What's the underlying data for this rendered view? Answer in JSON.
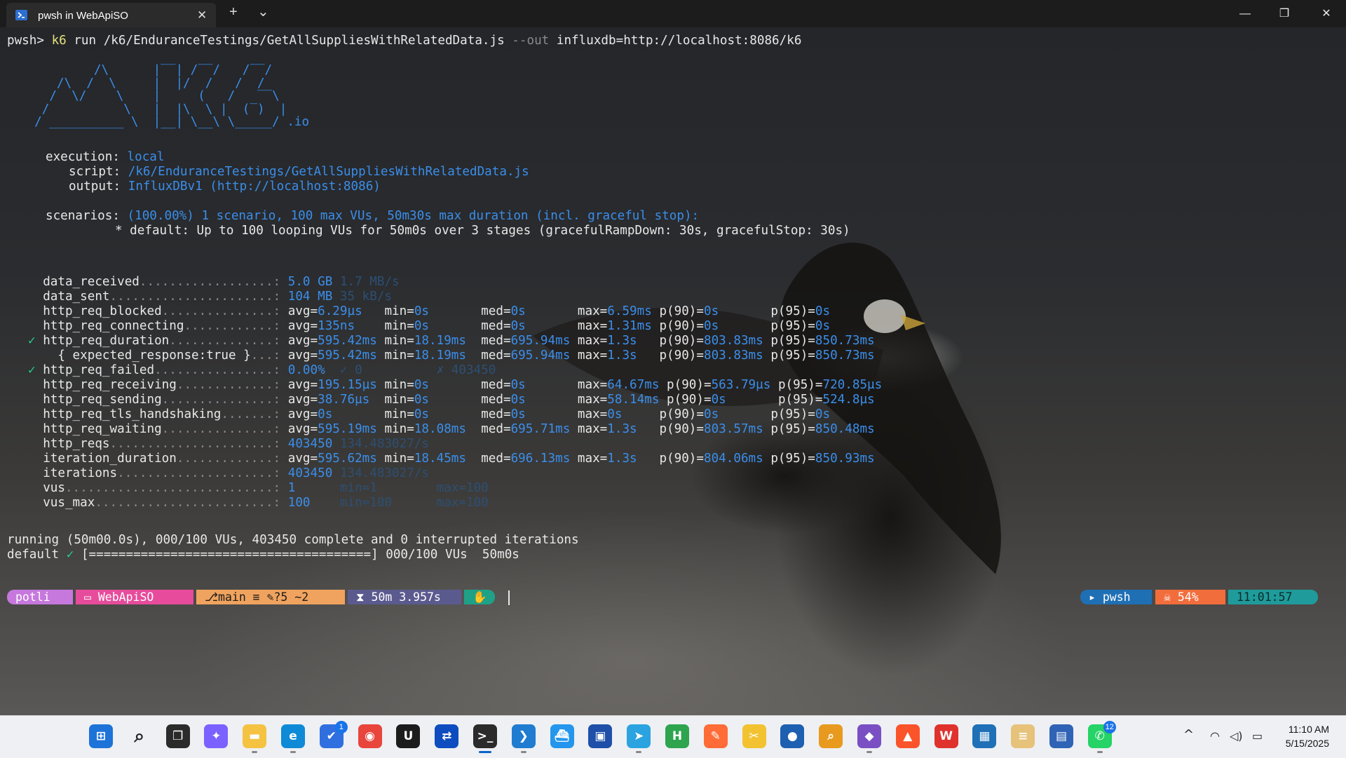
{
  "window": {
    "tab_title": "pwsh in WebApiSO",
    "tab_close": "✕",
    "new_tab": "+",
    "dropdown": "⌄",
    "minimize": "—",
    "maximize": "❐",
    "close": "✕"
  },
  "terminal": {
    "command": {
      "prompt": "pwsh>",
      "cmd": "k6",
      "args": "run /k6/EnduranceTestings/GetAllSuppliesWithRelatedData.js",
      "flag": "--out",
      "flag_value": "influxdb=http://localhost:8086/k6"
    },
    "logo_lines": [
      "          /\\      |‾‾| /‾‾/   /‾‾/   ",
      "     /\\  /  \\     |  |/  /   /  /    ",
      "    /  \\/    \\    |     (   /   ‾‾\\  ",
      "   /          \\   |  |\\  \\ |  (‾)  | ",
      "  / __________ \\  |__| \\__\\ \\_____/ .io"
    ],
    "execution": {
      "execution_label": "execution:",
      "execution_value": "local",
      "script_label": "script:",
      "script_value": "/k6/EnduranceTestings/GetAllSuppliesWithRelatedData.js",
      "output_label": "output:",
      "output_value": "InfluxDBv1 (http://localhost:8086)",
      "scenarios_label": "scenarios:",
      "scenarios_value": "(100.00%) 1 scenario, 100 max VUs, 50m30s max duration (incl. graceful stop):",
      "default_line": "* default: Up to 100 looping VUs for 50m0s over 3 stages (gracefulRampDown: 30s, gracefulStop: 30s)"
    },
    "metrics": [
      {
        "check": "",
        "name": "data_received",
        "dots": "..................:",
        "cols": [
          {
            "t": "5.0 GB",
            "w": 7,
            "c": "b"
          },
          {
            "t": "1.7 MB/s",
            "w": 0,
            "c": "fade"
          }
        ]
      },
      {
        "check": "",
        "name": "data_sent",
        "dots": "......................:",
        "cols": [
          {
            "t": "104 MB",
            "w": 7,
            "c": "b"
          },
          {
            "t": "35 kB/s",
            "w": 0,
            "c": "fade"
          }
        ]
      },
      {
        "check": "",
        "name": "http_req_blocked",
        "dots": "...............:",
        "cols": [
          {
            "t": "avg=",
            "v": "6.29µs",
            "w": 13
          },
          {
            "t": "min=",
            "v": "0s",
            "w": 13
          },
          {
            "t": "med=",
            "v": "0s",
            "w": 13
          },
          {
            "t": "max=",
            "v": "6.59ms",
            "w": 11
          },
          {
            "t": "p(90)=",
            "v": "0s",
            "w": 15
          },
          {
            "t": "p(95)=",
            "v": "0s",
            "w": 0
          }
        ]
      },
      {
        "check": "",
        "name": "http_req_connecting",
        "dots": "............:",
        "cols": [
          {
            "t": "avg=",
            "v": "135ns",
            "w": 13
          },
          {
            "t": "min=",
            "v": "0s",
            "w": 13
          },
          {
            "t": "med=",
            "v": "0s",
            "w": 13
          },
          {
            "t": "max=",
            "v": "1.31ms",
            "w": 11
          },
          {
            "t": "p(90)=",
            "v": "0s",
            "w": 15
          },
          {
            "t": "p(95)=",
            "v": "0s",
            "w": 0
          }
        ]
      },
      {
        "check": "✓",
        "name": "http_req_duration",
        "dots": "..............:",
        "cols": [
          {
            "t": "avg=",
            "v": "595.42ms",
            "w": 13
          },
          {
            "t": "min=",
            "v": "18.19ms",
            "w": 13
          },
          {
            "t": "med=",
            "v": "695.94ms",
            "w": 13
          },
          {
            "t": "max=",
            "v": "1.3s",
            "w": 11
          },
          {
            "t": "p(90)=",
            "v": "803.83ms",
            "w": 15
          },
          {
            "t": "p(95)=",
            "v": "850.73ms",
            "w": 0
          }
        ]
      },
      {
        "check": "",
        "name": "  { expected_response:true }",
        "dots": "...:",
        "cols": [
          {
            "t": "avg=",
            "v": "595.42ms",
            "w": 13
          },
          {
            "t": "min=",
            "v": "18.19ms",
            "w": 13
          },
          {
            "t": "med=",
            "v": "695.94ms",
            "w": 13
          },
          {
            "t": "max=",
            "v": "1.3s",
            "w": 11
          },
          {
            "t": "p(90)=",
            "v": "803.83ms",
            "w": 15
          },
          {
            "t": "p(95)=",
            "v": "850.73ms",
            "w": 0
          }
        ]
      },
      {
        "check": "✓",
        "name": "http_req_failed",
        "dots": "................:",
        "cols": [
          {
            "t": "0.00%",
            "w": 7,
            "c": "b"
          },
          {
            "t": "✓ 0",
            "w": 13,
            "c": "fade"
          },
          {
            "t": "✗ 403450",
            "w": 0,
            "c": "fade"
          }
        ]
      },
      {
        "check": "",
        "name": "http_req_receiving",
        "dots": ".............:",
        "cols": [
          {
            "t": "avg=",
            "v": "195.15µs",
            "w": 13
          },
          {
            "t": "min=",
            "v": "0s",
            "w": 13
          },
          {
            "t": "med=",
            "v": "0s",
            "w": 13
          },
          {
            "t": "max=",
            "v": "64.67ms",
            "w": 11
          },
          {
            "t": "p(90)=",
            "v": "563.79µs",
            "w": 15
          },
          {
            "t": "p(95)=",
            "v": "720.85µs",
            "w": 0
          }
        ]
      },
      {
        "check": "",
        "name": "http_req_sending",
        "dots": "...............:",
        "cols": [
          {
            "t": "avg=",
            "v": "38.76µs",
            "w": 13
          },
          {
            "t": "min=",
            "v": "0s",
            "w": 13
          },
          {
            "t": "med=",
            "v": "0s",
            "w": 13
          },
          {
            "t": "max=",
            "v": "58.14ms",
            "w": 11
          },
          {
            "t": "p(90)=",
            "v": "0s",
            "w": 15
          },
          {
            "t": "p(95)=",
            "v": "524.8µs",
            "w": 0
          }
        ]
      },
      {
        "check": "",
        "name": "http_req_tls_handshaking",
        "dots": ".......:",
        "cols": [
          {
            "t": "avg=",
            "v": "0s",
            "w": 13
          },
          {
            "t": "min=",
            "v": "0s",
            "w": 13
          },
          {
            "t": "med=",
            "v": "0s",
            "w": 13
          },
          {
            "t": "max=",
            "v": "0s",
            "w": 11
          },
          {
            "t": "p(90)=",
            "v": "0s",
            "w": 15
          },
          {
            "t": "p(95)=",
            "v": "0s",
            "w": 0
          }
        ]
      },
      {
        "check": "",
        "name": "http_req_waiting",
        "dots": "...............:",
        "cols": [
          {
            "t": "avg=",
            "v": "595.19ms",
            "w": 13
          },
          {
            "t": "min=",
            "v": "18.08ms",
            "w": 13
          },
          {
            "t": "med=",
            "v": "695.71ms",
            "w": 13
          },
          {
            "t": "max=",
            "v": "1.3s",
            "w": 11
          },
          {
            "t": "p(90)=",
            "v": "803.57ms",
            "w": 15
          },
          {
            "t": "p(95)=",
            "v": "850.48ms",
            "w": 0
          }
        ]
      },
      {
        "check": "",
        "name": "http_reqs",
        "dots": "......................:",
        "cols": [
          {
            "t": "403450",
            "w": 7,
            "c": "b"
          },
          {
            "t": "134.483027/s",
            "w": 0,
            "c": "fade"
          }
        ]
      },
      {
        "check": "",
        "name": "iteration_duration",
        "dots": ".............:",
        "cols": [
          {
            "t": "avg=",
            "v": "595.62ms",
            "w": 13
          },
          {
            "t": "min=",
            "v": "18.45ms",
            "w": 13
          },
          {
            "t": "med=",
            "v": "696.13ms",
            "w": 13
          },
          {
            "t": "max=",
            "v": "1.3s",
            "w": 11
          },
          {
            "t": "p(90)=",
            "v": "804.06ms",
            "w": 15
          },
          {
            "t": "p(95)=",
            "v": "850.93ms",
            "w": 0
          }
        ]
      },
      {
        "check": "",
        "name": "iterations",
        "dots": ".....................:",
        "cols": [
          {
            "t": "403450",
            "w": 7,
            "c": "b"
          },
          {
            "t": "134.483027/s",
            "w": 0,
            "c": "fade"
          }
        ]
      },
      {
        "check": "",
        "name": "vus",
        "dots": "............................:",
        "cols": [
          {
            "t": "1",
            "w": 7,
            "c": "b"
          },
          {
            "t": "min=1",
            "w": 13,
            "c": "fade"
          },
          {
            "t": "max=100",
            "w": 0,
            "c": "fade"
          }
        ]
      },
      {
        "check": "",
        "name": "vus_max",
        "dots": "........................:",
        "cols": [
          {
            "t": "100",
            "w": 7,
            "c": "b"
          },
          {
            "t": "min=100",
            "w": 13,
            "c": "fade"
          },
          {
            "t": "max=100",
            "w": 0,
            "c": "fade"
          }
        ]
      }
    ],
    "status": {
      "running_line": "running (50m00.0s), 000/100 VUs, 403450 complete and 0 interrupted iterations",
      "default_label": "default",
      "default_check": "✓",
      "progress_bar": "[======================================]",
      "progress_text": "000/100 VUs  50m0s"
    },
    "prompt_segments": {
      "user": "potli",
      "folder": "WebApiSO",
      "git": "main ≡",
      "git_changes": "?5 ~2",
      "duration": "50m 3.957s",
      "shell": "pwsh",
      "battery": "54%",
      "time": "11:01:57"
    }
  },
  "taskbar": {
    "apps": [
      "windows-start",
      "search",
      "task-view",
      "copilot",
      "file-explorer",
      "edge",
      "todo",
      "chrome",
      "upwork",
      "teamviewer",
      "terminal",
      "vscode",
      "docker",
      "save",
      "telegram",
      "hackerrank",
      "postman",
      "tools",
      "recorder",
      "search-tool",
      "visual-studio",
      "brave",
      "wps",
      "mobaxterm",
      "notes",
      "network",
      "whatsapp"
    ],
    "badges": {
      "todo": "1",
      "whatsapp": "12"
    },
    "tray_chevron": "^",
    "clock_time": "11:10 AM",
    "clock_date": "5/15/2025"
  },
  "colors": {
    "accent": "#3b8eea",
    "check": "#23d18b",
    "highlight": "#e5e17a"
  }
}
